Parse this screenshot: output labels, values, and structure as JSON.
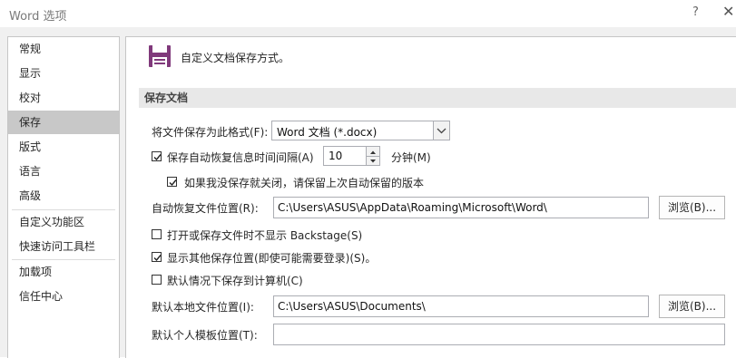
{
  "window": {
    "title": "Word 选项",
    "help": "?",
    "close": "✕"
  },
  "sidebar": {
    "items": [
      {
        "label": "常规",
        "selected": false
      },
      {
        "label": "显示",
        "selected": false
      },
      {
        "label": "校对",
        "selected": false
      },
      {
        "label": "保存",
        "selected": true
      },
      {
        "label": "版式",
        "selected": false
      },
      {
        "label": "语言",
        "selected": false
      },
      {
        "label": "高级",
        "selected": false
      },
      {
        "label": "自定义功能区",
        "selected": false
      },
      {
        "label": "快速访问工具栏",
        "selected": false
      },
      {
        "label": "加载项",
        "selected": false
      },
      {
        "label": "信任中心",
        "selected": false
      }
    ]
  },
  "main": {
    "heading": "自定义文档保存方式。",
    "section_title": "保存文档",
    "format": {
      "label": "将文件保存为此格式(F):",
      "value": "Word 文档 (*.docx)"
    },
    "autorecover": {
      "label": "保存自动恢复信息时间间隔(A)",
      "checked": true,
      "value": "10",
      "unit": "分钟(M)"
    },
    "keep_last": {
      "label": "如果我没保存就关闭，请保留上次自动保留的版本",
      "checked": true
    },
    "autorecover_location": {
      "label": "自动恢复文件位置(R):",
      "value": "C:\\Users\\ASUS\\AppData\\Roaming\\Microsoft\\Word\\",
      "button": "浏览(B)..."
    },
    "no_backstage": {
      "label": "打开或保存文件时不显示 Backstage(S)",
      "checked": false
    },
    "show_other": {
      "label": "显示其他保存位置(即使可能需要登录)(S)。",
      "checked": true
    },
    "save_computer": {
      "label": "默认情况下保存到计算机(C)",
      "checked": false
    },
    "local_location": {
      "label": "默认本地文件位置(I):",
      "value": "C:\\Users\\ASUS\\Documents\\",
      "button": "浏览(B)..."
    },
    "template_location": {
      "label": "默认个人模板位置(T):",
      "value": ""
    }
  },
  "colors": {
    "save_icon": "#80397b",
    "selected_nav": "#c8c8c8",
    "section_bg": "#e8e8e8"
  }
}
